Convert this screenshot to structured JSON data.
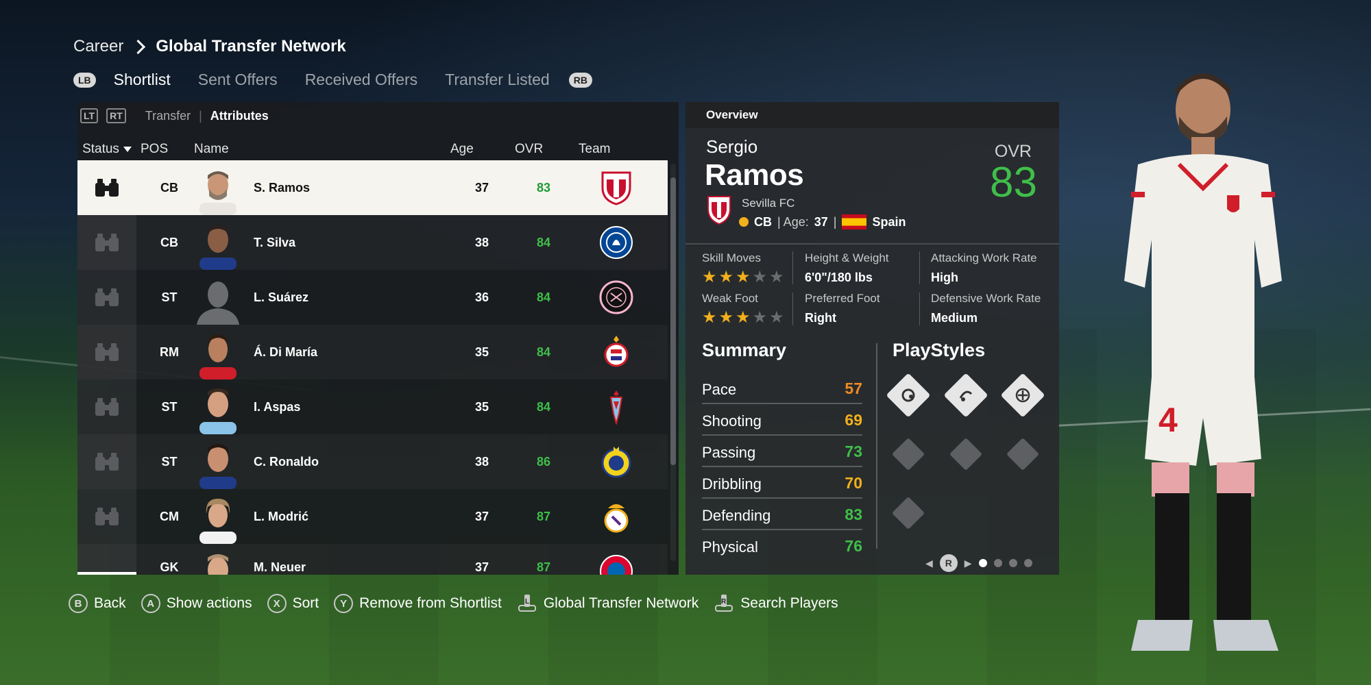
{
  "breadcrumb": {
    "root": "Career",
    "current": "Global Transfer Network"
  },
  "tabs": {
    "left_button": "LB",
    "right_button": "RB",
    "items": [
      "Shortlist",
      "Sent Offers",
      "Received Offers",
      "Transfer Listed"
    ],
    "active": "Shortlist"
  },
  "subtabs": {
    "left_button": "LT",
    "right_button": "RT",
    "transfer": "Transfer",
    "separator": "|",
    "attributes": "Attributes"
  },
  "columns": {
    "status": "Status",
    "pos": "POS",
    "name": "Name",
    "age": "Age",
    "ovr": "OVR",
    "team": "Team"
  },
  "players": [
    {
      "pos": "CB",
      "name": "S. Ramos",
      "age": "37",
      "ovr": "83",
      "team_icon": "sevilla-crest",
      "selected": true
    },
    {
      "pos": "CB",
      "name": "T. Silva",
      "age": "38",
      "ovr": "84",
      "team_icon": "chelsea-crest"
    },
    {
      "pos": "ST",
      "name": "L. Suárez",
      "age": "36",
      "ovr": "84",
      "team_icon": "inter-miami-crest"
    },
    {
      "pos": "RM",
      "name": "Á. Di María",
      "age": "35",
      "ovr": "84",
      "team_icon": "benfica-crest"
    },
    {
      "pos": "ST",
      "name": "I. Aspas",
      "age": "35",
      "ovr": "84",
      "team_icon": "celta-crest"
    },
    {
      "pos": "ST",
      "name": "C. Ronaldo",
      "age": "38",
      "ovr": "86",
      "team_icon": "al-nassr-crest"
    },
    {
      "pos": "CM",
      "name": "L. Modrić",
      "age": "37",
      "ovr": "87",
      "team_icon": "real-madrid-crest"
    },
    {
      "pos": "GK",
      "name": "M. Neuer",
      "age": "37",
      "ovr": "87",
      "team_icon": "bayern-crest"
    }
  ],
  "overview": {
    "title": "Overview",
    "first_name": "Sergio",
    "last_name": "Ramos",
    "ovr_label": "OVR",
    "ovr": "83",
    "club": "Sevilla FC",
    "position": "CB",
    "age_label": "| Age:",
    "age": "37",
    "sep": "|",
    "nation": "Spain",
    "skill_moves_label": "Skill Moves",
    "skill_moves_stars": 3,
    "weak_foot_label": "Weak Foot",
    "weak_foot_stars": 3,
    "height_weight_label": "Height & Weight",
    "height_weight": "6'0\"/180 lbs",
    "preferred_foot_label": "Preferred Foot",
    "preferred_foot": "Right",
    "attacking_wr_label": "Attacking Work Rate",
    "attacking_wr": "High",
    "defensive_wr_label": "Defensive Work Rate",
    "defensive_wr": "Medium",
    "summary_title": "Summary",
    "playstyles_title": "PlayStyles",
    "summary": [
      {
        "label": "Pace",
        "value": "57",
        "color": "#f08a24"
      },
      {
        "label": "Shooting",
        "value": "69",
        "color": "#f1b01c"
      },
      {
        "label": "Passing",
        "value": "73",
        "color": "#3fbf4a"
      },
      {
        "label": "Dribbling",
        "value": "70",
        "color": "#f1b01c"
      },
      {
        "label": "Defending",
        "value": "83",
        "color": "#3fbf4a"
      },
      {
        "label": "Physical",
        "value": "76",
        "color": "#3fbf4a"
      }
    ],
    "pager_button": "R",
    "pager_pages": 4,
    "pager_current": 1
  },
  "footer": [
    {
      "button": "B",
      "label": "Back"
    },
    {
      "button": "A",
      "label": "Show actions"
    },
    {
      "button": "X",
      "label": "Sort"
    },
    {
      "button": "Y",
      "label": "Remove from Shortlist"
    },
    {
      "button": "L",
      "label": "Global Transfer Network"
    },
    {
      "button": "R",
      "label": "Search Players"
    }
  ],
  "colors": {
    "ovr_green": "#3fbf4a",
    "star_gold": "#f1b01c",
    "panel": "#1a1c1f"
  }
}
